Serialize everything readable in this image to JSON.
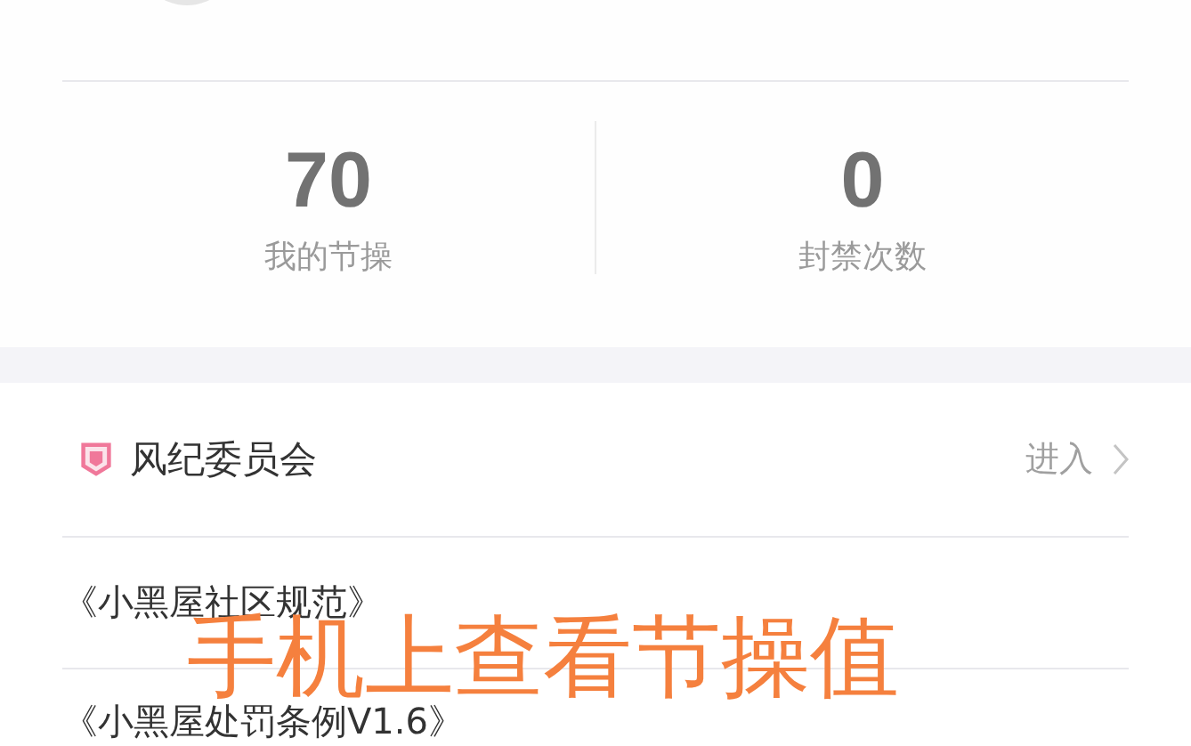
{
  "stats": [
    {
      "value": "70",
      "label": "我的节操"
    },
    {
      "value": "0",
      "label": "封禁次数"
    }
  ],
  "committee": {
    "title": "风纪委员会",
    "action": "进入"
  },
  "links": [
    "《小黑屋社区规范》",
    "《小黑屋处罚条例V1.6》"
  ],
  "caption": "手机上查看节操值"
}
